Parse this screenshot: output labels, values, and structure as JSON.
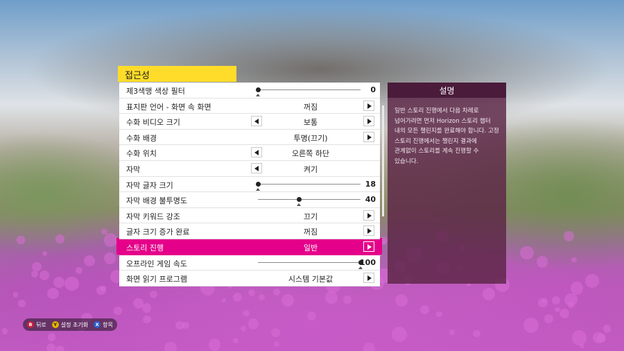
{
  "panel": {
    "title": "접근성"
  },
  "settings": [
    {
      "label": "제3색맹 색상 필터",
      "type": "slider",
      "level": 0.0,
      "value": "0"
    },
    {
      "label": "표지판 언어 - 화면 속 화면",
      "type": "toggle",
      "value": "꺼짐",
      "left": false,
      "right": true
    },
    {
      "label": "수화 비디오 크기",
      "type": "select",
      "value": "보통",
      "left": true,
      "right": true
    },
    {
      "label": "수화 배경",
      "type": "select",
      "value": "투명(끄기)",
      "left": false,
      "right": true
    },
    {
      "label": "수화 위치",
      "type": "select",
      "value": "오른쪽 하단",
      "left": true,
      "right": false
    },
    {
      "label": "자막",
      "type": "select",
      "value": "켜기",
      "left": true,
      "right": false
    },
    {
      "label": "자막 글자 크기",
      "type": "slider",
      "level": 0.0,
      "value": "18"
    },
    {
      "label": "자막 배경 불투명도",
      "type": "slider",
      "level": 0.4,
      "value": "40"
    },
    {
      "label": "자막 키워드 강조",
      "type": "toggle",
      "value": "끄기",
      "left": false,
      "right": true
    },
    {
      "label": "글자 크기 증가 완료",
      "type": "toggle",
      "value": "꺼짐",
      "left": false,
      "right": true
    },
    {
      "label": "스토리 진행",
      "type": "select",
      "value": "일반",
      "left": false,
      "right": true,
      "active": true
    },
    {
      "label": "오프라인 게임 속도",
      "type": "slider",
      "level": 1.0,
      "value": "100"
    },
    {
      "label": "화면 읽기 프로그램",
      "type": "select",
      "value": "시스템 기본값",
      "left": false,
      "right": true
    }
  ],
  "description": {
    "title": "설명",
    "text": "일반 스토리 진행에서 다음 차례로 넘어가려면 먼저 Horizon 스토리 챕터 내의 모든 챌린지를 완료해야 합니다. 고정 스토리 진행에서는 챌린지 결과에 관계없이 스토리를 계속 진행할 수 있습니다."
  },
  "footer": [
    {
      "button": "B",
      "icon": "b-button-icon",
      "label": "뒤로",
      "color": "#c8233a"
    },
    {
      "button": "Y",
      "icon": "y-button-icon",
      "label": "설정 초기화",
      "color": "#e3b100"
    },
    {
      "button": "X",
      "icon": "x-button-icon",
      "label": "항목",
      "color": "#2c5fc8"
    }
  ],
  "colors": {
    "accent": "#e5008a",
    "header": "#ffdc2a",
    "description_bg": "#5c2446"
  }
}
